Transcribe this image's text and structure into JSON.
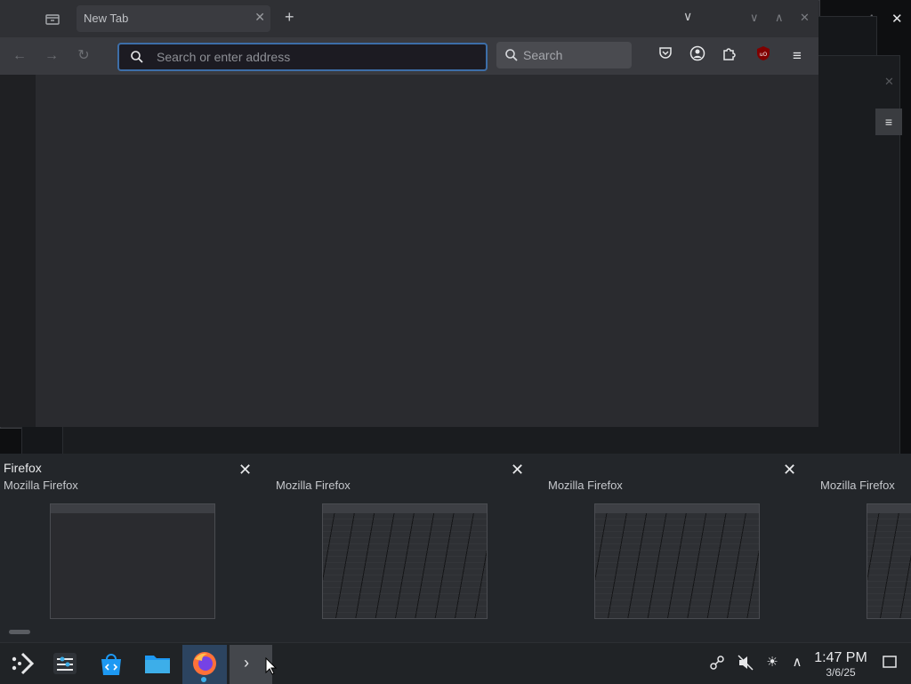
{
  "browser": {
    "tab_title": "New Tab",
    "url_placeholder": "Search or enter address",
    "search_placeholder": "Search"
  },
  "switcher": {
    "cards": [
      {
        "title": "Firefox",
        "subtitle": "Mozilla Firefox"
      },
      {
        "title": "",
        "subtitle": "Mozilla Firefox"
      },
      {
        "title": "",
        "subtitle": "Mozilla Firefox"
      },
      {
        "title": "",
        "subtitle": "Mozilla Firefox"
      }
    ]
  },
  "taskbar": {
    "time": "1:47 PM",
    "date": "3/6/25"
  },
  "colors": {
    "accent": "#3b6ca8",
    "firefox_orange": "#ff7139",
    "ublock_red": "#800000"
  }
}
